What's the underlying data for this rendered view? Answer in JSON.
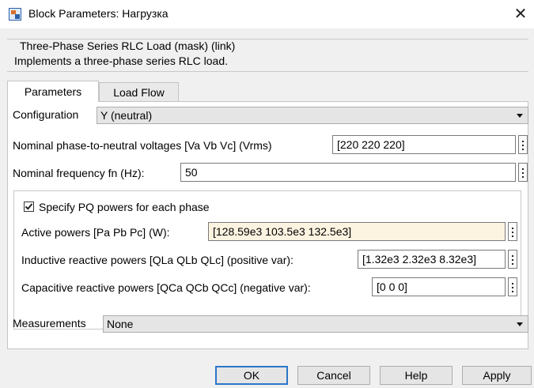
{
  "window": {
    "title": "Block Parameters: Нагрузка",
    "close_glyph": "✕"
  },
  "header": {
    "group_title": "Three-Phase Series RLC Load (mask) (link)",
    "description": "Implements a three-phase series RLC load."
  },
  "tabs": [
    {
      "label": "Parameters",
      "active": true
    },
    {
      "label": "Load Flow",
      "active": false
    }
  ],
  "params": {
    "configuration": {
      "label": "Configuration",
      "value": "Y (neutral)"
    },
    "voltage": {
      "label": "Nominal phase-to-neutral voltages [Va Vb Vc] (Vrms)",
      "value": "[220 220 220]"
    },
    "frequency": {
      "label": "Nominal frequency fn (Hz):",
      "value": "50"
    },
    "specify_pq": {
      "label": "Specify PQ powers for each phase",
      "checked": true
    },
    "active_powers": {
      "label": "Active powers [Pa Pb Pc] (W):",
      "value": "[128.59e3 103.5e3 132.5e3]"
    },
    "inductive_powers": {
      "label": "Inductive reactive powers [QLa QLb QLc] (positive var):",
      "value": "[1.32e3 2.32e3 8.32e3]"
    },
    "capacitive_powers": {
      "label": "Capacitive reactive powers [QCa QCb QCc] (negative var):",
      "value": "[0 0 0]"
    },
    "measurements": {
      "label": "Measurements",
      "value": "None"
    }
  },
  "buttons": {
    "ok": "OK",
    "cancel": "Cancel",
    "help": "Help",
    "apply": "Apply"
  },
  "icons": {
    "app": "simulink-block-icon",
    "close": "close-icon",
    "dropdown": "chevron-down-icon",
    "more": "vertical-ellipsis-icon"
  },
  "colors": {
    "dialog_background": "#f0f0f0",
    "highlighted_field": "#fdf3e1",
    "default_button_border": "#2b76c9"
  }
}
